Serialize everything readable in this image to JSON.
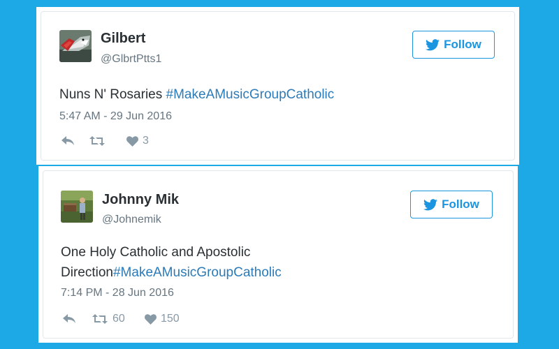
{
  "colors": {
    "background": "#1da9e6",
    "accent": "#1b95e0",
    "hashtag": "#2b7bb9",
    "text": "#292f33",
    "muted": "#66757f",
    "icon": "#8899a6"
  },
  "tweets": [
    {
      "name": "Gilbert",
      "handle": "@GlbrtPtts1",
      "follow_label": "Follow",
      "text_line1": "Nuns N' Rosaries ",
      "text_line1_hashtag": "#MakeAMusicGroupCatholic",
      "text_line2": "",
      "text_line2_hashtag": "",
      "time": "5:47 AM - 29 Jun 2016",
      "retweets": "",
      "likes": "3",
      "avatar_icon": "shark-avatar"
    },
    {
      "name": "Johnny Mik",
      "handle": "@Johnemik",
      "follow_label": "Follow",
      "text_line1": "One Holy Catholic and Apostolic",
      "text_line1_hashtag": "",
      "text_line2": "Direction",
      "text_line2_hashtag": "#MakeAMusicGroupCatholic",
      "time": "7:14 PM - 28 Jun 2016",
      "retweets": "60",
      "likes": "150",
      "avatar_icon": "outdoor-person-avatar"
    }
  ],
  "icons": {
    "follow": "twitter-bird-icon",
    "reply": "reply-icon",
    "retweet": "retweet-icon",
    "like": "heart-icon"
  }
}
